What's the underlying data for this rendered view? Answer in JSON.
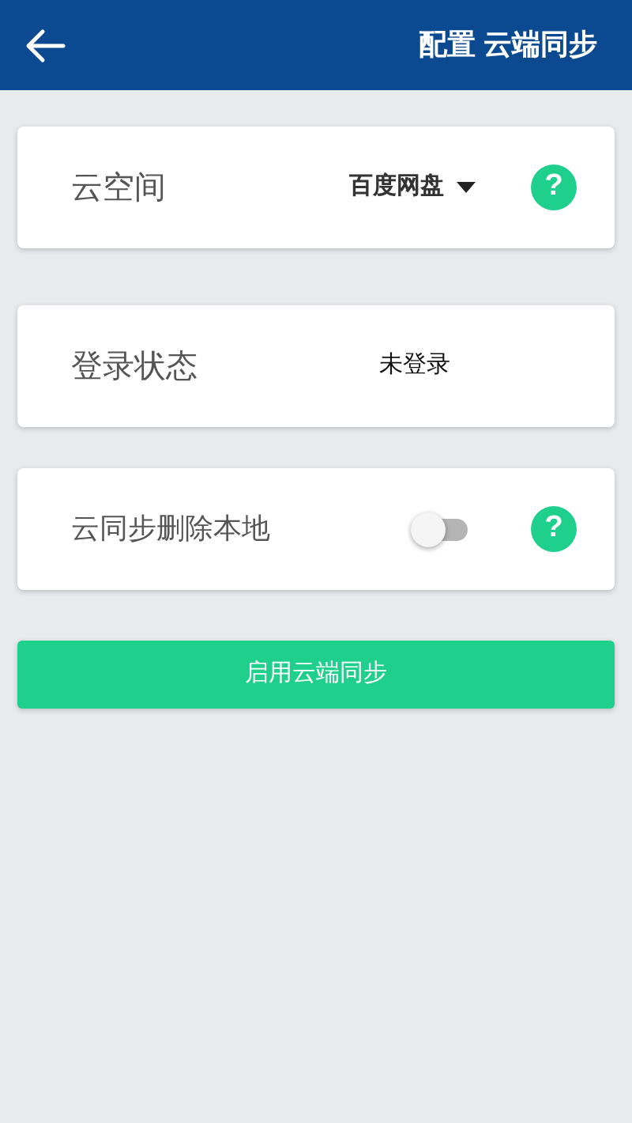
{
  "header": {
    "title": "配置 云端同步"
  },
  "settings": [
    {
      "kind": "dropdown",
      "label": "云空间",
      "value": "百度网盘",
      "help": "?"
    },
    {
      "kind": "text",
      "label": "登录状态",
      "value": "未登录"
    },
    {
      "kind": "toggle",
      "label": "云同步删除本地",
      "on": false,
      "help": "?"
    }
  ],
  "button": "启用云端同步"
}
